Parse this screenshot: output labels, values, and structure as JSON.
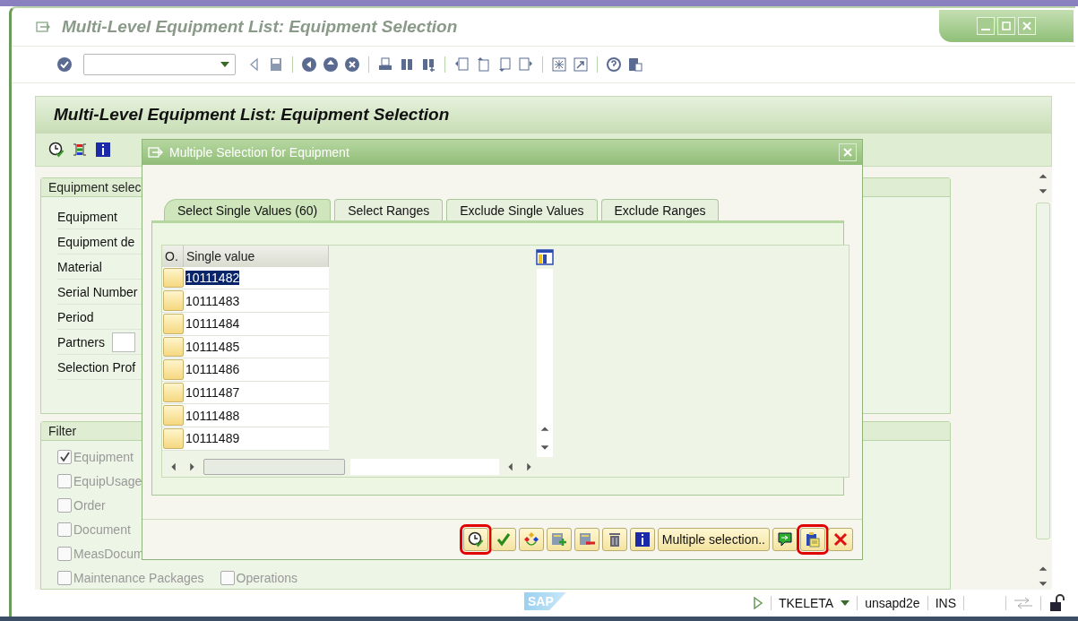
{
  "window": {
    "title": "Multi-Level Equipment List: Equipment Selection"
  },
  "screen": {
    "title": "Multi-Level Equipment List: Equipment Selection"
  },
  "selection_group": {
    "title": "Equipment selec",
    "fields": [
      {
        "label": "Equipment",
        "kind": "text"
      },
      {
        "label": "Equipment de",
        "kind": "text"
      },
      {
        "label": "Material",
        "kind": "text"
      },
      {
        "label": "Serial Number",
        "kind": "text"
      },
      {
        "label": "Period",
        "kind": "text"
      },
      {
        "label": "Partners",
        "kind": "input"
      },
      {
        "label": "Selection Prof",
        "kind": "text"
      }
    ]
  },
  "filter_group": {
    "title": "Filter",
    "options": [
      {
        "label": "Equipment",
        "checked": true
      },
      {
        "label": "EquipUsage",
        "checked": false
      },
      {
        "label": "Order",
        "checked": false
      },
      {
        "label": "Document",
        "checked": false
      },
      {
        "label": "MeasDocum",
        "checked": false
      },
      {
        "label": "Maintenance Packages",
        "checked": false
      },
      {
        "label": "Operations",
        "checked": false
      }
    ]
  },
  "dialog": {
    "title": "Multiple Selection for Equipment",
    "tabs": [
      {
        "label": "Select Single Values (60)",
        "selected": true
      },
      {
        "label": "Select Ranges",
        "selected": false
      },
      {
        "label": "Exclude Single Values",
        "selected": false
      },
      {
        "label": "Exclude Ranges",
        "selected": false
      }
    ],
    "table": {
      "columns": [
        "O.",
        "Single value"
      ],
      "rows": [
        {
          "value": "10111482",
          "selected": true
        },
        {
          "value": "10111483",
          "selected": false
        },
        {
          "value": "10111484",
          "selected": false
        },
        {
          "value": "10111485",
          "selected": false
        },
        {
          "value": "10111486",
          "selected": false
        },
        {
          "value": "10111487",
          "selected": false
        },
        {
          "value": "10111488",
          "selected": false
        },
        {
          "value": "10111489",
          "selected": false
        }
      ]
    },
    "buttons": [
      {
        "kind": "icon",
        "highlighted": true
      },
      {
        "kind": "icon",
        "highlighted": false
      },
      {
        "kind": "icon",
        "highlighted": false
      },
      {
        "kind": "icon",
        "highlighted": false
      },
      {
        "kind": "icon",
        "highlighted": false
      },
      {
        "kind": "icon",
        "highlighted": false
      },
      {
        "kind": "icon",
        "highlighted": false
      },
      {
        "kind": "text",
        "label": "Multiple selection..",
        "highlighted": false
      },
      {
        "kind": "icon",
        "highlighted": false
      },
      {
        "kind": "icon",
        "highlighted": true
      },
      {
        "kind": "icon",
        "highlighted": false
      }
    ]
  },
  "status_bar": {
    "logo": "SAP",
    "user": "TKELETA",
    "server": "unsapd2e",
    "mode": "INS"
  }
}
